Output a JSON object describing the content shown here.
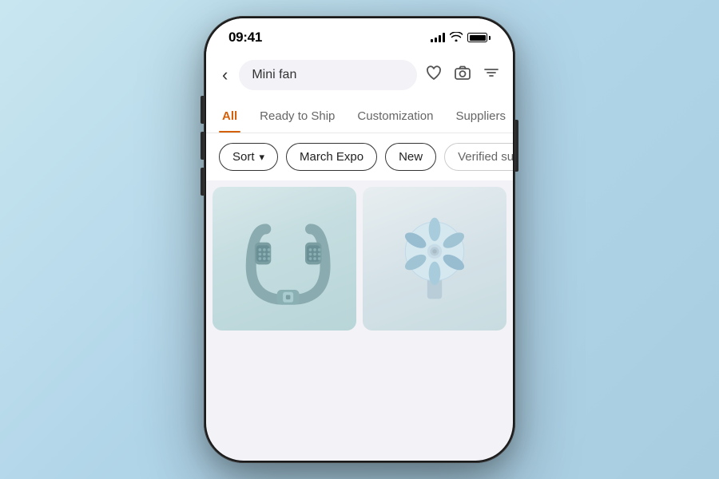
{
  "statusBar": {
    "time": "09:41"
  },
  "searchBar": {
    "value": "Mini fan",
    "backLabel": "‹"
  },
  "tabs": [
    {
      "id": "all",
      "label": "All",
      "active": true
    },
    {
      "id": "ready",
      "label": "Ready to Ship",
      "active": false
    },
    {
      "id": "customization",
      "label": "Customization",
      "active": false
    },
    {
      "id": "suppliers",
      "label": "Suppliers",
      "active": false
    }
  ],
  "filters": [
    {
      "id": "sort",
      "label": "Sort",
      "hasChevron": true
    },
    {
      "id": "march-expo",
      "label": "March Expo",
      "hasChevron": false
    },
    {
      "id": "new",
      "label": "New",
      "hasChevron": false
    },
    {
      "id": "verified",
      "label": "Verified supplier",
      "hasChevron": false
    }
  ],
  "products": [
    {
      "id": "neck-fan",
      "type": "neck-fan"
    },
    {
      "id": "hand-fan",
      "type": "hand-fan"
    }
  ],
  "icons": {
    "back": "‹",
    "heart": "♡",
    "camera": "⊡",
    "filter": "⧩",
    "chevron": "⌄"
  }
}
